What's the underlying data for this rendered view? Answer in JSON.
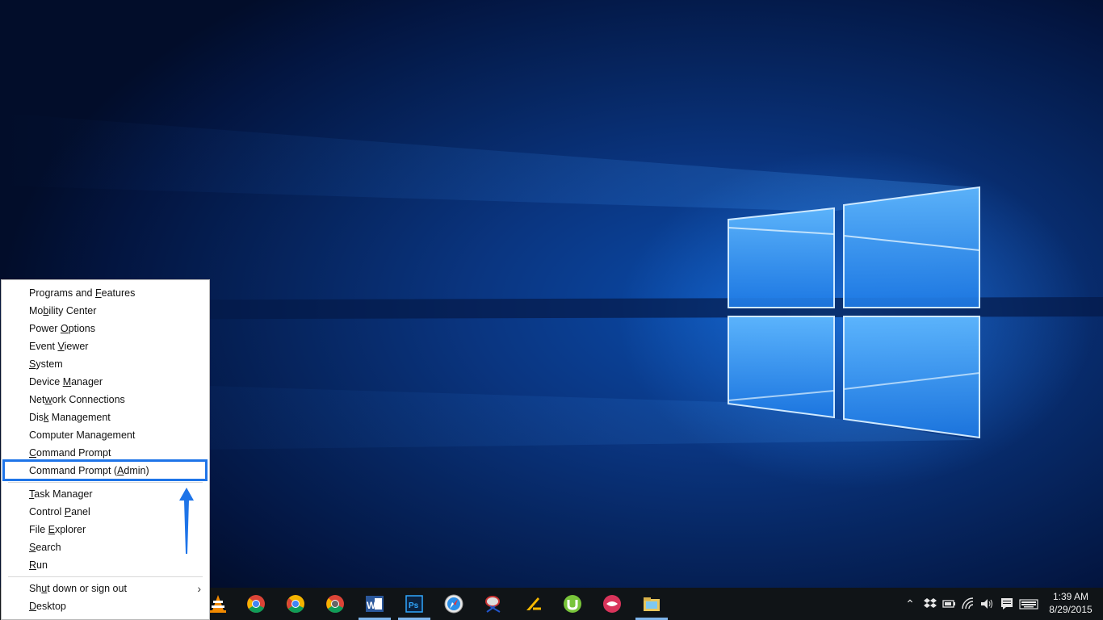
{
  "menu": {
    "items": [
      {
        "pre": "Programs and ",
        "key": "F",
        "post": "eatures"
      },
      {
        "pre": "Mo",
        "key": "b",
        "post": "ility Center"
      },
      {
        "pre": "Power ",
        "key": "O",
        "post": "ptions"
      },
      {
        "pre": "Event ",
        "key": "V",
        "post": "iewer"
      },
      {
        "pre": "",
        "key": "S",
        "post": "ystem"
      },
      {
        "pre": "Device ",
        "key": "M",
        "post": "anager"
      },
      {
        "pre": "Net",
        "key": "w",
        "post": "ork Connections"
      },
      {
        "pre": "Dis",
        "key": "k",
        "post": " Management"
      },
      {
        "pre": "Computer Mana",
        "key": "g",
        "post": "ement"
      },
      {
        "pre": "",
        "key": "C",
        "post": "ommand Prompt"
      },
      {
        "pre": "Command Prompt (",
        "key": "A",
        "post": "dmin)"
      },
      {
        "pre": "",
        "key": "T",
        "post": "ask Manager"
      },
      {
        "pre": "Control ",
        "key": "P",
        "post": "anel"
      },
      {
        "pre": "File ",
        "key": "E",
        "post": "xplorer"
      },
      {
        "pre": "",
        "key": "S",
        "post": "earch"
      },
      {
        "pre": "",
        "key": "R",
        "post": "un"
      },
      {
        "pre": "Sh",
        "key": "u",
        "post": "t down or sign out"
      },
      {
        "pre": "",
        "key": "D",
        "post": "esktop"
      }
    ],
    "submenu_arrow": "›"
  },
  "taskbar": {
    "icons": [
      "vlc-icon",
      "chrome-icon",
      "chrome-canary-icon",
      "chrome-dev-icon",
      "word-icon",
      "photoshop-icon",
      "safari-icon",
      "snipping-tool-icon",
      "filezilla-icon",
      "utorrent-icon",
      "kiss-icon",
      "file-explorer-icon"
    ],
    "highlight_color": "#1e74e8"
  },
  "tray": {
    "icons": [
      "chevron-up-icon",
      "dropbox-icon",
      "battery-icon",
      "wifi-icon",
      "volume-icon",
      "action-center-icon",
      "keyboard-icon"
    ],
    "time": "1:39 AM",
    "date": "8/29/2015"
  }
}
